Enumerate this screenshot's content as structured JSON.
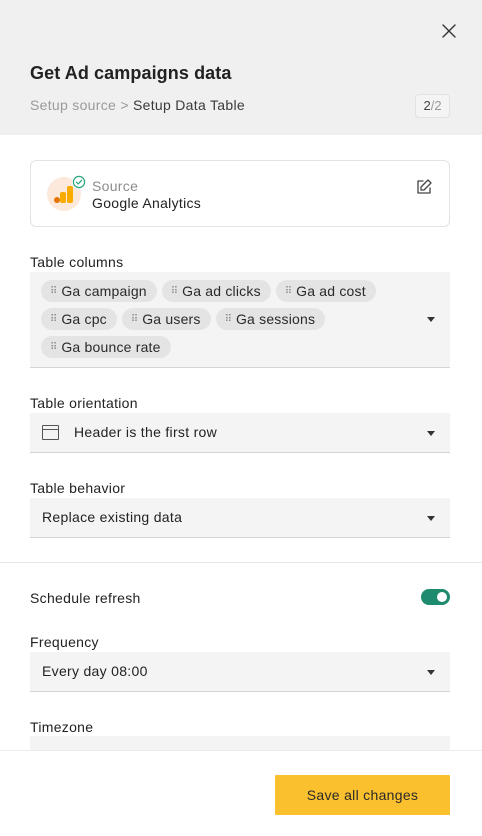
{
  "panel": {
    "title": "Get Ad campaigns data",
    "breadcrumb": {
      "previous": "Setup source",
      "separator": ">",
      "current": "Setup Data Table"
    },
    "step": {
      "current": "2",
      "separator": "/",
      "total": "2"
    }
  },
  "source": {
    "label": "Source",
    "name": "Google Analytics",
    "status": "connected",
    "icons": {
      "logo": "google-analytics-logo",
      "status": "check-circle-icon",
      "edit": "edit-icon"
    }
  },
  "table_columns": {
    "label": "Table columns",
    "chips": [
      "Ga campaign",
      "Ga ad clicks",
      "Ga ad cost",
      "Ga cpc",
      "Ga users",
      "Ga sessions",
      "Ga bounce rate"
    ]
  },
  "table_orientation": {
    "label": "Table orientation",
    "value": "Header is the first row"
  },
  "table_behavior": {
    "label": "Table behavior",
    "value": "Replace existing data"
  },
  "schedule": {
    "label": "Schedule refresh",
    "enabled": true
  },
  "frequency": {
    "label": "Frequency",
    "value": "Every day 08:00"
  },
  "timezone": {
    "label": "Timezone"
  },
  "footer": {
    "save_label": "Save all changes"
  },
  "colors": {
    "accent": "#fbc02d",
    "toggle_on": "#1e8a6e",
    "header_bg": "#f0f0f0",
    "ga_orange": "#f9ab00",
    "ga_dark_orange": "#e37400",
    "check_green": "#27a67a"
  }
}
